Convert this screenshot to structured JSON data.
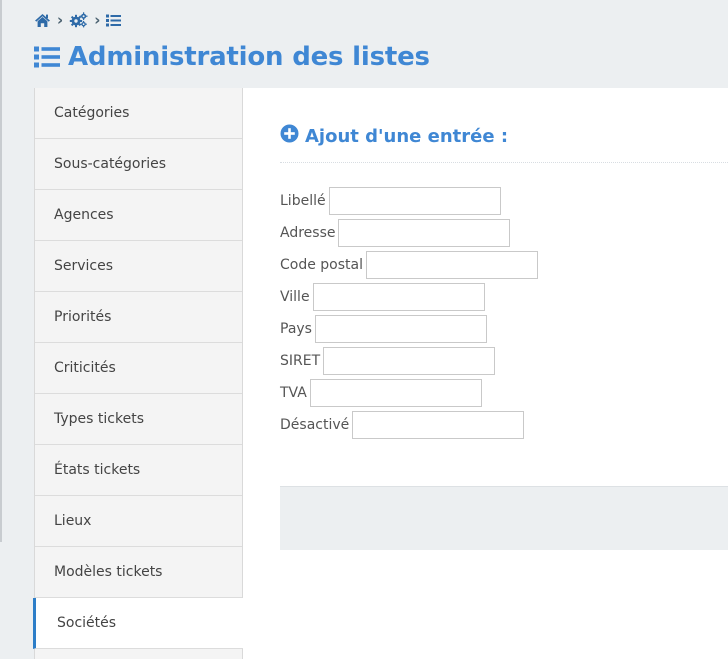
{
  "header": {
    "title": "Administration des listes",
    "breadcrumb": [
      {
        "icon": "home-icon"
      },
      {
        "icon": "gears-icon"
      },
      {
        "icon": "list-icon"
      }
    ],
    "breadcrumb_separator": "›"
  },
  "sidebar": {
    "items": [
      {
        "label": "Catégories"
      },
      {
        "label": "Sous-catégories"
      },
      {
        "label": "Agences"
      },
      {
        "label": "Services"
      },
      {
        "label": "Priorités"
      },
      {
        "label": "Criticités"
      },
      {
        "label": "Types tickets"
      },
      {
        "label": "États tickets"
      },
      {
        "label": "Lieux"
      },
      {
        "label": "Modèles tickets"
      },
      {
        "label": "Sociétés",
        "active": true
      }
    ]
  },
  "main": {
    "section_title": "Ajout d'une entrée :",
    "section_icon": "plus-circle-icon",
    "fields": [
      {
        "label": "Libellé",
        "value": ""
      },
      {
        "label": "Adresse",
        "value": ""
      },
      {
        "label": "Code postal",
        "value": ""
      },
      {
        "label": "Ville",
        "value": ""
      },
      {
        "label": "Pays",
        "value": ""
      },
      {
        "label": "SIRET",
        "value": ""
      },
      {
        "label": "TVA",
        "value": ""
      },
      {
        "label": "Désactivé",
        "value": ""
      }
    ]
  },
  "colors": {
    "accent": "#3f87d4",
    "breadcrumb_icon": "#2e6aa8",
    "active_border": "#2d7ec8",
    "background": "#eceff1"
  }
}
